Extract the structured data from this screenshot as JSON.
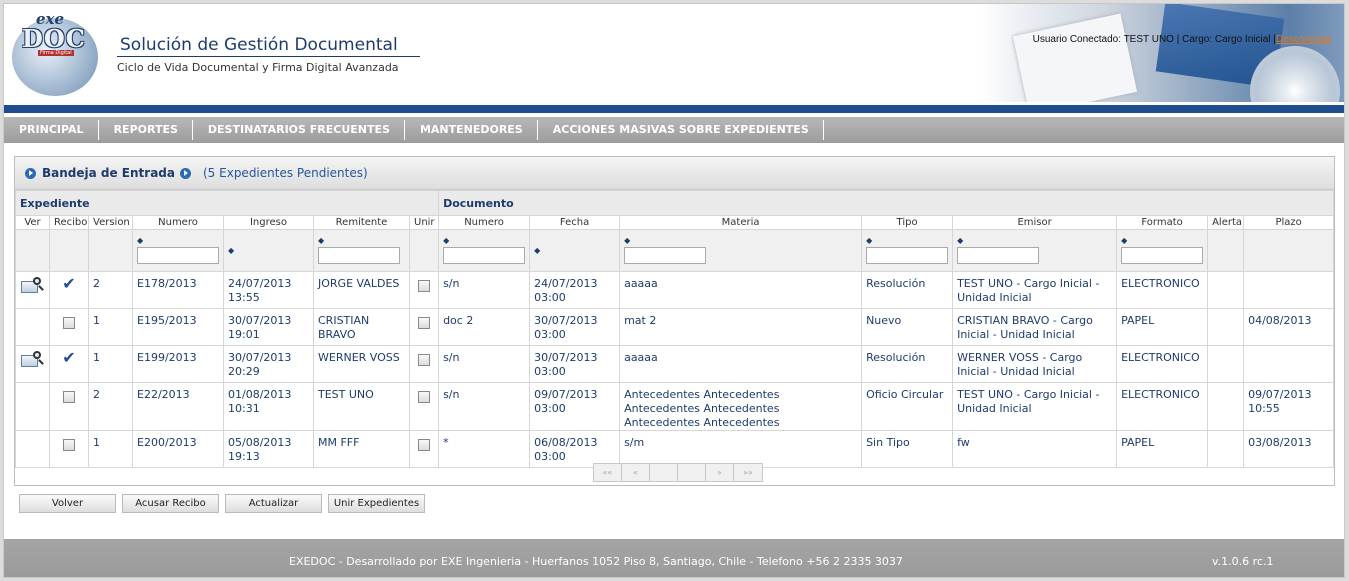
{
  "header": {
    "logo_top": "exe",
    "logo_main": "DOC",
    "logo_sub": "Firma Digital",
    "title": "Solución de Gestión Documental",
    "subtitle": "Ciclo de Vida Documental y Firma Digital Avanzada",
    "user_info": "Usuario Conectado: TEST UNO | Cargo: Cargo Inicial |",
    "logout": "Desconectar"
  },
  "nav": [
    "PRINCIPAL",
    "REPORTES",
    "DESTINATARIOS FRECUENTES",
    "MANTENEDORES",
    "ACCIONES MASIVAS SOBRE EXPEDIENTES"
  ],
  "inbox": {
    "title": "Bandeja de Entrada",
    "pending": "(5 Expedientes Pendientes)"
  },
  "table": {
    "groups": [
      "Expediente",
      "Documento"
    ],
    "columns": [
      "Ver",
      "Recibo",
      "Version",
      "Numero",
      "Ingreso",
      "Remitente",
      "Unir",
      "Numero",
      "Fecha",
      "Materia",
      "Tipo",
      "Emisor",
      "Formato",
      "Alerta",
      "Plazo"
    ],
    "sort_glyph": "◆",
    "check_glyph": "✔",
    "rows": [
      {
        "ver": true,
        "recibo": "checked",
        "version": "2",
        "numero": "E178/2013",
        "ingreso": "24/07/2013 13:55",
        "remitente": "JORGE VALDES",
        "doc_numero": "s/n",
        "fecha": "24/07/2013 03:00",
        "materia": "aaaaa",
        "tipo": "Resolución",
        "emisor": "TEST UNO - Cargo Inicial - Unidad Inicial",
        "formato": "ELECTRONICO",
        "alerta": "",
        "plazo": "",
        "plazo_alert": false
      },
      {
        "ver": false,
        "recibo": "box",
        "version": "1",
        "numero": "E195/2013",
        "ingreso": "30/07/2013 19:01",
        "remitente": "CRISTIAN BRAVO",
        "doc_numero": "doc 2",
        "fecha": "30/07/2013 03:00",
        "materia": "mat 2",
        "tipo": "Nuevo",
        "emisor": "CRISTIAN BRAVO - Cargo Inicial - Unidad Inicial",
        "formato": "PAPEL",
        "alerta": "",
        "plazo": "04/08/2013",
        "plazo_alert": false
      },
      {
        "ver": true,
        "recibo": "checked",
        "version": "1",
        "numero": "E199/2013",
        "ingreso": "30/07/2013 20:29",
        "remitente": "WERNER VOSS",
        "doc_numero": "s/n",
        "fecha": "30/07/2013 03:00",
        "materia": "aaaaa",
        "tipo": "Resolución",
        "emisor": "WERNER VOSS - Cargo Inicial - Unidad Inicial",
        "formato": "ELECTRONICO",
        "alerta": "",
        "plazo": "",
        "plazo_alert": false
      },
      {
        "ver": false,
        "recibo": "box",
        "version": "2",
        "numero": "E22/2013",
        "ingreso": "01/08/2013 10:31",
        "remitente": "TEST UNO",
        "doc_numero": "s/n",
        "fecha": "09/07/2013 03:00",
        "materia": "Antecedentes Antecedentes Antecedentes Antecedentes Antecedentes Antecedentes",
        "tipo": "Oficio Circular",
        "emisor": "TEST UNO - Cargo Inicial - Unidad Inicial",
        "formato": "ELECTRONICO",
        "alerta": "",
        "plazo": "09/07/2013 10:55",
        "plazo_alert": true
      },
      {
        "ver": false,
        "recibo": "box",
        "version": "1",
        "numero": "E200/2013",
        "ingreso": "05/08/2013 19:13",
        "remitente": "MM FFF",
        "doc_numero": "*",
        "fecha": "06/08/2013 03:00",
        "materia": "s/m",
        "tipo": "Sin Tipo",
        "emisor": "fw",
        "formato": "PAPEL",
        "alerta": "",
        "plazo": "03/08/2013",
        "plazo_alert": false
      }
    ]
  },
  "pager": [
    "««",
    "«",
    "",
    "",
    "»",
    "»»"
  ],
  "buttons": [
    "Volver",
    "Acusar Recibo",
    "Actualizar",
    "Unir Expedientes"
  ],
  "footer": {
    "text": "EXEDOC - Desarrollado por EXE Ingenieria - Huerfanos 1052 Piso 8, Santiago, Chile - Telefono +56 2 2335 3037",
    "version": "v.1.0.6 rc.1"
  },
  "colors": {
    "accent": "#1f4e8f",
    "alert": "#cc2222",
    "logout_link": "#e07a1a"
  }
}
